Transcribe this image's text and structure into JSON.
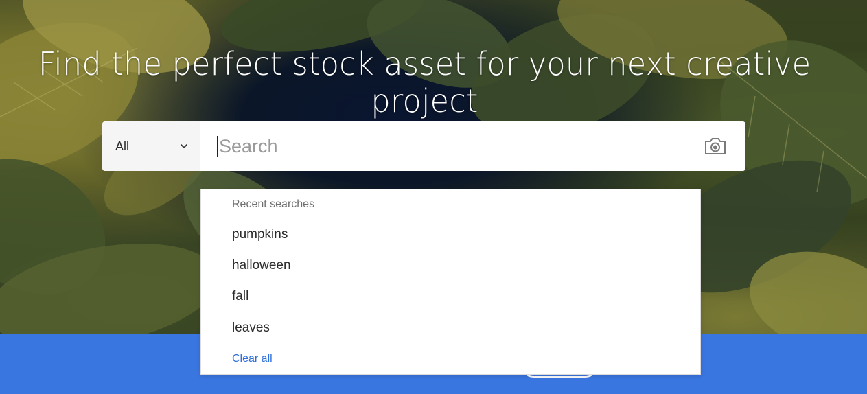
{
  "hero": {
    "headline": "Find the perfect stock asset for your next creative project"
  },
  "search": {
    "filter_label": "All",
    "placeholder": "Search",
    "value": "",
    "camera_icon": "camera-icon",
    "chevron_icon": "chevron-down-icon"
  },
  "recent_searches": {
    "header": "Recent searches",
    "items": [
      "pumpkins",
      "halloween",
      "fall",
      "leaves"
    ],
    "clear_label": "Clear all"
  },
  "colors": {
    "band_blue": "#3a76e0",
    "link_blue": "#2e6fdc"
  }
}
